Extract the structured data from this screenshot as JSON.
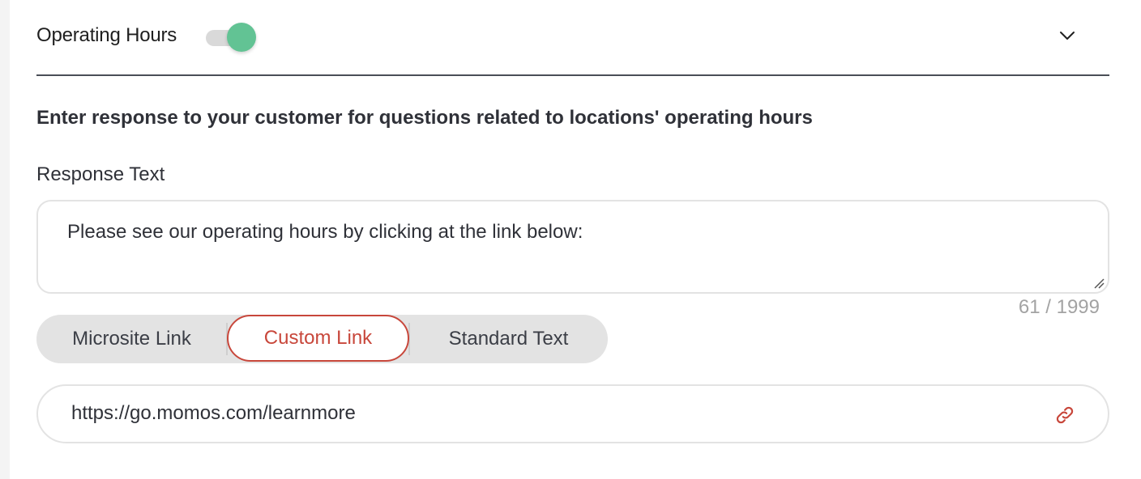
{
  "section": {
    "title": "Operating Hours",
    "enabled": true,
    "toggle_color": "#62c394",
    "collapse_icon": "chevron-down-icon"
  },
  "description": "Enter response to your customer for questions related to locations' operating hours",
  "response": {
    "label": "Response Text",
    "value": "Please see our operating hours by clicking at the link below:",
    "counter": "61 / 1999"
  },
  "link_type": {
    "options": [
      "Microsite Link",
      "Custom Link",
      "Standard Text"
    ],
    "selected": "Custom Link",
    "accent_color": "#c8473b"
  },
  "custom_link": {
    "value": "https://go.momos.com/learnmore",
    "icon": "link-icon"
  }
}
